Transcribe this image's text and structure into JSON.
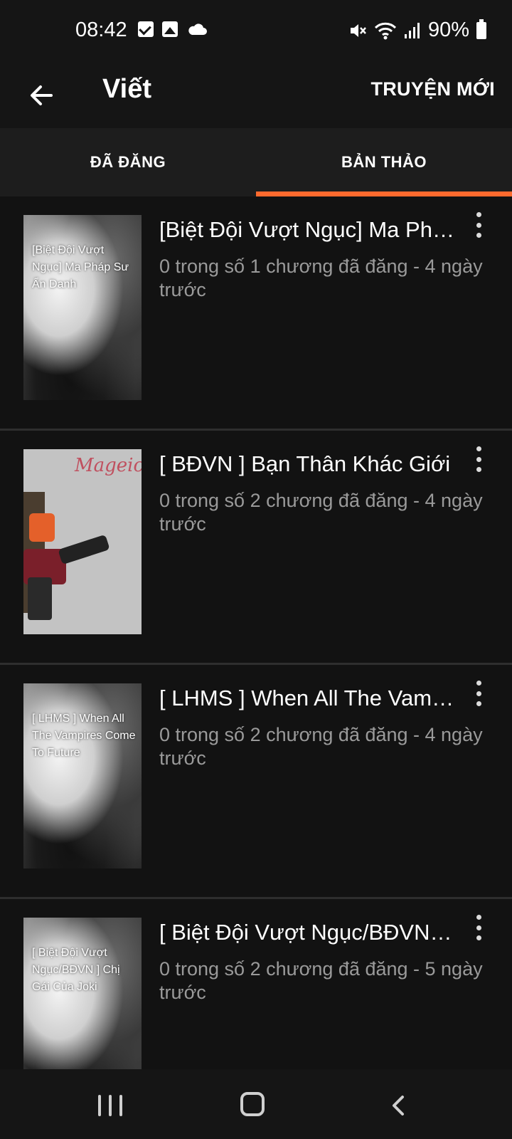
{
  "status_bar": {
    "time": "08:42",
    "left_icons": [
      "check-box-icon",
      "image-icon",
      "cloud-icon"
    ],
    "right_icons": [
      "mute-icon",
      "wifi-icon",
      "signal-icon",
      "battery-icon"
    ],
    "battery": "90%"
  },
  "app_bar": {
    "back_icon": "arrow-left-icon",
    "title": "Viết",
    "action": "TRUYỆN MỚI"
  },
  "tabs": [
    {
      "label": "ĐÃ ĐĂNG",
      "active": false
    },
    {
      "label": "BẢN THẢO",
      "active": true
    }
  ],
  "accent_color": "#ff6a2e",
  "stories": [
    {
      "title": "[Biệt Đội Vượt Ngục] Ma Pháp Sư Ẩn Danh",
      "meta": "0 trong số 1 chương đã đăng - 4 ngày trước",
      "cover_text": "[Biệt Đội Vượt Ngục] Ma Pháp Sư Ẩn Danh"
    },
    {
      "title": "[ BĐVN ] Bạn Thân Khác Giới",
      "meta": "0 trong số 2 chương đã đăng - 4 ngày trước",
      "cover_text": "Mageic M"
    },
    {
      "title": "[ LHMS ] When All The Vampires Come To Future",
      "meta": "0 trong số 2 chương đã đăng - 4 ngày trước",
      "cover_text": "[ LHMS ] When All The Vampires Come To Future"
    },
    {
      "title": "[ Biệt Đội Vượt Ngục/BĐVN ] Chị Gái Của Joki",
      "meta": "0 trong số 2 chương đã đăng - 5 ngày trước",
      "cover_text": "[ Biệt Đội Vượt Ngục/BĐVN ] Chị Gái Của Joki"
    }
  ],
  "nav_bar": [
    "recents-icon",
    "home-icon",
    "back-icon"
  ]
}
